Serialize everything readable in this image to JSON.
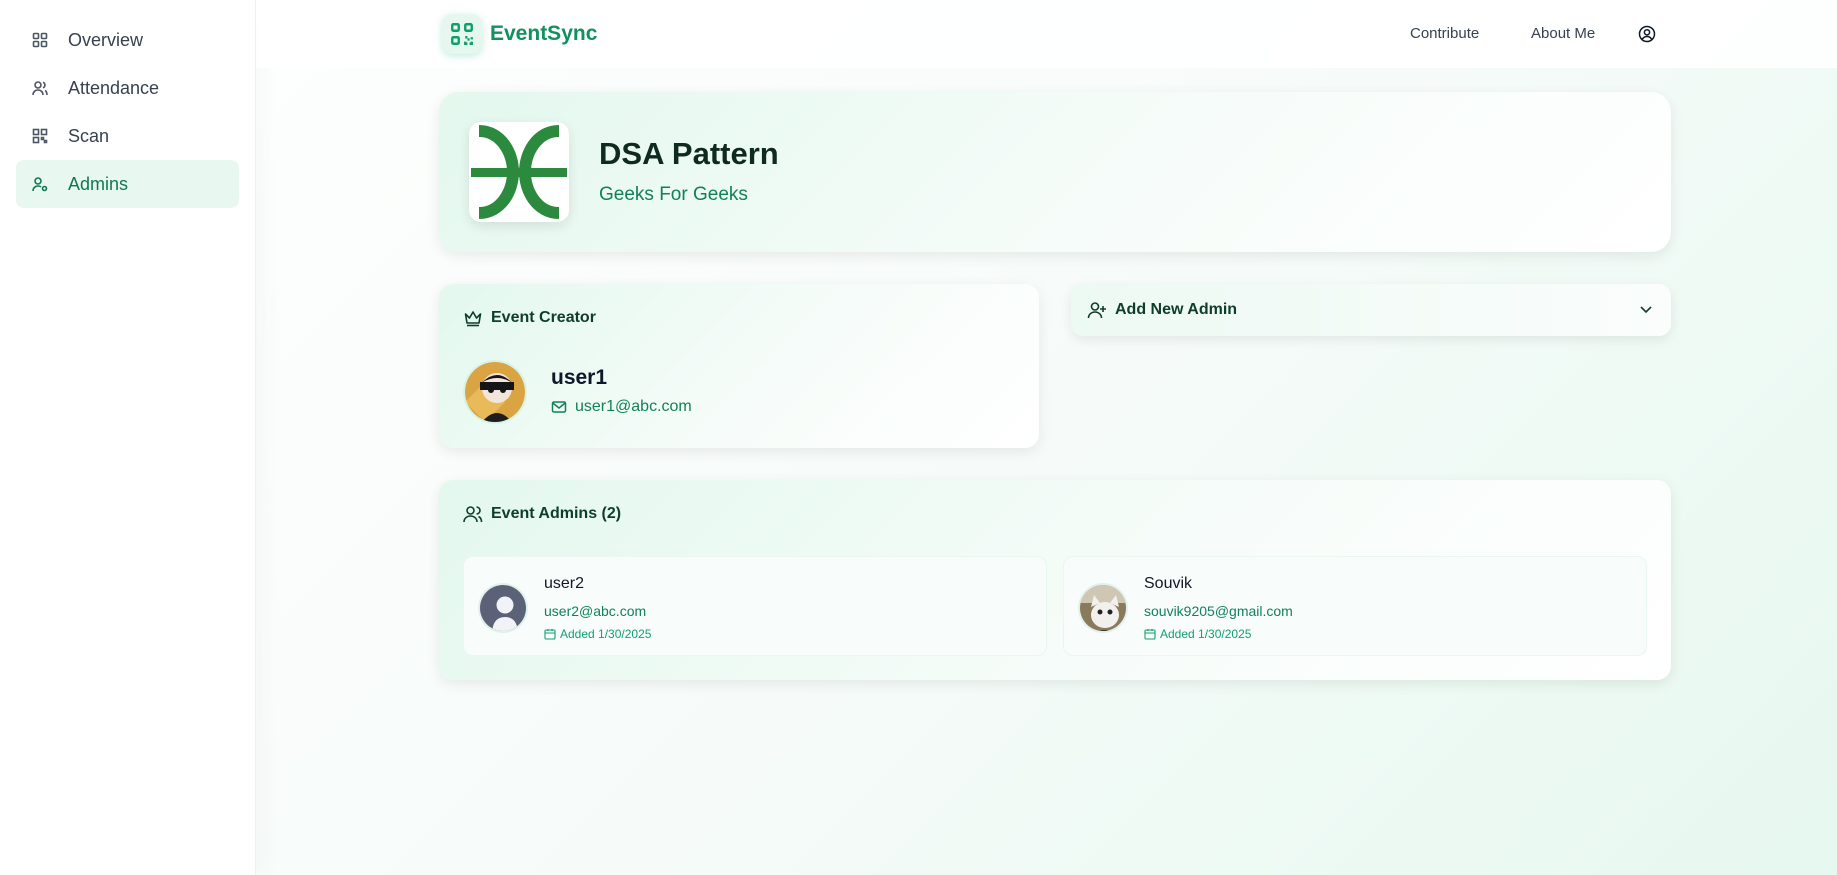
{
  "sidebar": {
    "items": [
      {
        "label": "Overview",
        "icon": "grid-icon"
      },
      {
        "label": "Attendance",
        "icon": "users-icon"
      },
      {
        "label": "Scan",
        "icon": "qr-icon"
      },
      {
        "label": "Admins",
        "icon": "user-cog-icon",
        "active": true
      }
    ]
  },
  "header": {
    "brand": "EventSync",
    "links": [
      "Contribute",
      "About Me"
    ]
  },
  "event": {
    "title": "DSA Pattern",
    "subtitle": "Geeks For Geeks"
  },
  "creator": {
    "heading": "Event Creator",
    "name": "user1",
    "email": "user1@abc.com"
  },
  "add_admin": {
    "label": "Add New Admin"
  },
  "admins": {
    "heading": "Event Admins (2)",
    "list": [
      {
        "name": "user2",
        "email": "user2@abc.com",
        "added": "Added 1/30/2025"
      },
      {
        "name": "Souvik",
        "email": "souvik9205@gmail.com",
        "added": "Added 1/30/2025"
      }
    ]
  },
  "colors": {
    "accent": "#12905f",
    "active_bg": "#e8f8f0",
    "logo_green": "#2b8a3e"
  }
}
